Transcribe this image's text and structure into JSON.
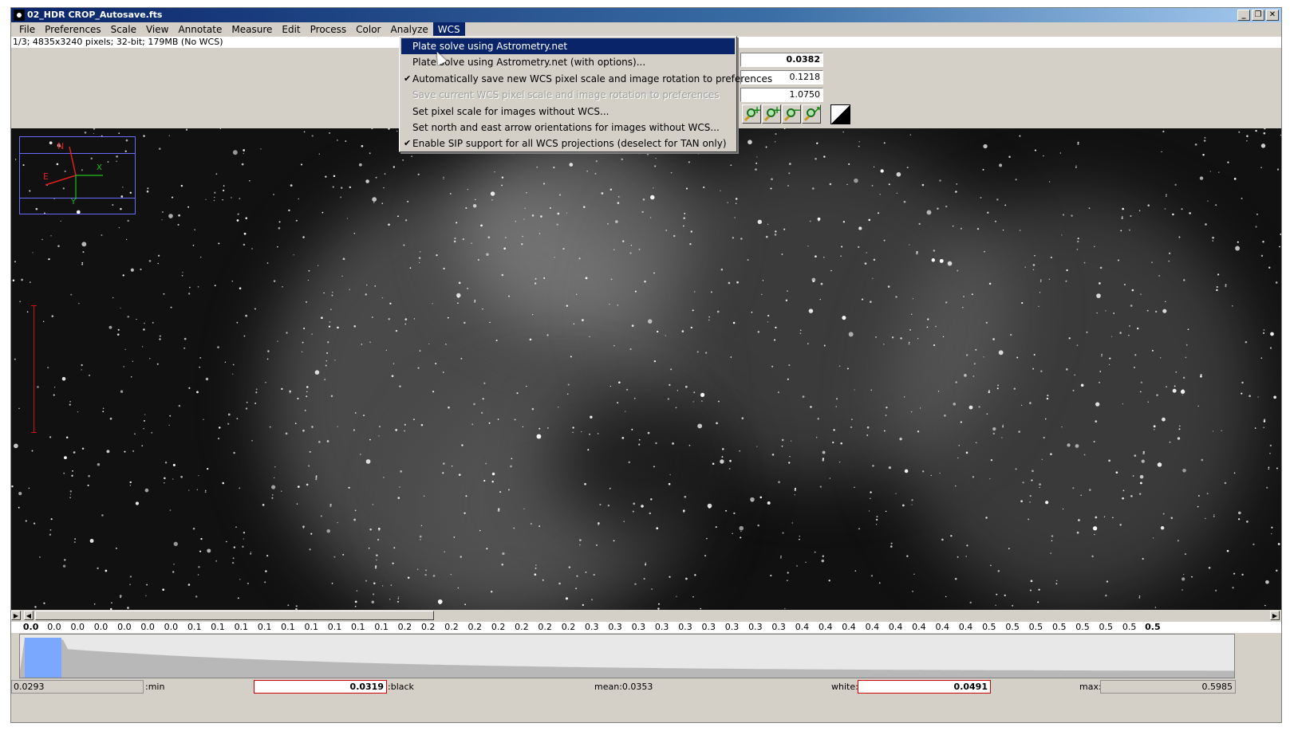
{
  "window": {
    "title": "02_HDR CROP_Autosave.fts",
    "buttons": {
      "minimize": "_",
      "restore": "❐",
      "close": "✕"
    }
  },
  "menubar": {
    "items": [
      "File",
      "Preferences",
      "Scale",
      "View",
      "Annotate",
      "Measure",
      "Edit",
      "Process",
      "Color",
      "Analyze",
      "WCS"
    ],
    "active": "WCS"
  },
  "info": "1/3; 4835x3240 pixels; 32-bit; 179MB (No WCS)",
  "toolbar": {
    "field1": "0.0382",
    "field2": "0.1218",
    "field3": "1.0750",
    "icons": [
      "zoom-in-icon",
      "zoom-in-icon",
      "zoom-out-icon",
      "zoom-fit-icon",
      "contrast-icon"
    ]
  },
  "wcs_menu": {
    "items": [
      {
        "label": "Plate solve using Astrometry.net",
        "state": "highlighted",
        "checked": false
      },
      {
        "label": "Plate solve using Astrometry.net (with options)...",
        "state": "normal",
        "checked": false
      },
      {
        "label": "Automatically save new WCS pixel scale and image rotation to preferences",
        "state": "normal",
        "checked": true
      },
      {
        "label": "Save current WCS pixel scale and image rotation to preferences",
        "state": "disabled",
        "checked": false
      },
      {
        "label": "Set pixel scale for images without WCS...",
        "state": "normal",
        "checked": false
      },
      {
        "label": "Set north and east arrow orientations for images without WCS...",
        "state": "normal",
        "checked": false
      },
      {
        "label": "Enable SIP support for all WCS projections (deselect for TAN only)",
        "state": "normal",
        "checked": true
      }
    ]
  },
  "overlay": {
    "north": "N",
    "east": "E",
    "x": "X",
    "y": "Y"
  },
  "histogram_ticks": [
    "0.0",
    "0.0",
    "0.0",
    "0.0",
    "0.0",
    "0.0",
    "0.0",
    "0.1",
    "0.1",
    "0.1",
    "0.1",
    "0.1",
    "0.1",
    "0.1",
    "0.1",
    "0.1",
    "0.2",
    "0.2",
    "0.2",
    "0.2",
    "0.2",
    "0.2",
    "0.2",
    "0.2",
    "0.3",
    "0.3",
    "0.3",
    "0.3",
    "0.3",
    "0.3",
    "0.3",
    "0.3",
    "0.3",
    "0.4",
    "0.4",
    "0.4",
    "0.4",
    "0.4",
    "0.4",
    "0.4",
    "0.4",
    "0.5",
    "0.5",
    "0.5",
    "0.5",
    "0.5",
    "0.5",
    "0.5",
    "0.5"
  ],
  "stats": {
    "min_value": "0.0293",
    "min_label": ":min",
    "black_value": "0.0319",
    "black_label": ":black",
    "mean": "mean:0.0353",
    "white_label": "white:",
    "white_value": "0.0491",
    "max_label": "max:",
    "max_value": "0.5985"
  },
  "colors": {
    "highlight": "#0a246a",
    "chrome": "#d4d0c8",
    "histogram_fill": "#7aa7ff",
    "field_border_active": "#d00000"
  }
}
